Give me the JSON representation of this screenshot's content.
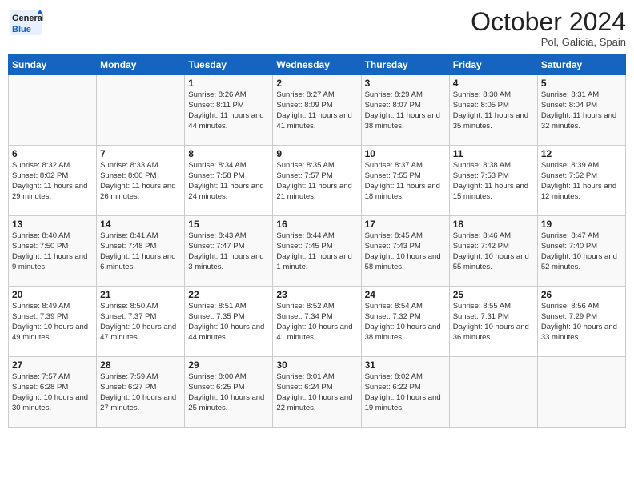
{
  "header": {
    "logo_general": "General",
    "logo_blue": "Blue",
    "month_title": "October 2024",
    "location": "Pol, Galicia, Spain"
  },
  "weekdays": [
    "Sunday",
    "Monday",
    "Tuesday",
    "Wednesday",
    "Thursday",
    "Friday",
    "Saturday"
  ],
  "weeks": [
    [
      {
        "day": "",
        "sunrise": "",
        "sunset": "",
        "daylight": ""
      },
      {
        "day": "",
        "sunrise": "",
        "sunset": "",
        "daylight": ""
      },
      {
        "day": "1",
        "sunrise": "Sunrise: 8:26 AM",
        "sunset": "Sunset: 8:11 PM",
        "daylight": "Daylight: 11 hours and 44 minutes."
      },
      {
        "day": "2",
        "sunrise": "Sunrise: 8:27 AM",
        "sunset": "Sunset: 8:09 PM",
        "daylight": "Daylight: 11 hours and 41 minutes."
      },
      {
        "day": "3",
        "sunrise": "Sunrise: 8:29 AM",
        "sunset": "Sunset: 8:07 PM",
        "daylight": "Daylight: 11 hours and 38 minutes."
      },
      {
        "day": "4",
        "sunrise": "Sunrise: 8:30 AM",
        "sunset": "Sunset: 8:05 PM",
        "daylight": "Daylight: 11 hours and 35 minutes."
      },
      {
        "day": "5",
        "sunrise": "Sunrise: 8:31 AM",
        "sunset": "Sunset: 8:04 PM",
        "daylight": "Daylight: 11 hours and 32 minutes."
      }
    ],
    [
      {
        "day": "6",
        "sunrise": "Sunrise: 8:32 AM",
        "sunset": "Sunset: 8:02 PM",
        "daylight": "Daylight: 11 hours and 29 minutes."
      },
      {
        "day": "7",
        "sunrise": "Sunrise: 8:33 AM",
        "sunset": "Sunset: 8:00 PM",
        "daylight": "Daylight: 11 hours and 26 minutes."
      },
      {
        "day": "8",
        "sunrise": "Sunrise: 8:34 AM",
        "sunset": "Sunset: 7:58 PM",
        "daylight": "Daylight: 11 hours and 24 minutes."
      },
      {
        "day": "9",
        "sunrise": "Sunrise: 8:35 AM",
        "sunset": "Sunset: 7:57 PM",
        "daylight": "Daylight: 11 hours and 21 minutes."
      },
      {
        "day": "10",
        "sunrise": "Sunrise: 8:37 AM",
        "sunset": "Sunset: 7:55 PM",
        "daylight": "Daylight: 11 hours and 18 minutes."
      },
      {
        "day": "11",
        "sunrise": "Sunrise: 8:38 AM",
        "sunset": "Sunset: 7:53 PM",
        "daylight": "Daylight: 11 hours and 15 minutes."
      },
      {
        "day": "12",
        "sunrise": "Sunrise: 8:39 AM",
        "sunset": "Sunset: 7:52 PM",
        "daylight": "Daylight: 11 hours and 12 minutes."
      }
    ],
    [
      {
        "day": "13",
        "sunrise": "Sunrise: 8:40 AM",
        "sunset": "Sunset: 7:50 PM",
        "daylight": "Daylight: 11 hours and 9 minutes."
      },
      {
        "day": "14",
        "sunrise": "Sunrise: 8:41 AM",
        "sunset": "Sunset: 7:48 PM",
        "daylight": "Daylight: 11 hours and 6 minutes."
      },
      {
        "day": "15",
        "sunrise": "Sunrise: 8:43 AM",
        "sunset": "Sunset: 7:47 PM",
        "daylight": "Daylight: 11 hours and 3 minutes."
      },
      {
        "day": "16",
        "sunrise": "Sunrise: 8:44 AM",
        "sunset": "Sunset: 7:45 PM",
        "daylight": "Daylight: 11 hours and 1 minute."
      },
      {
        "day": "17",
        "sunrise": "Sunrise: 8:45 AM",
        "sunset": "Sunset: 7:43 PM",
        "daylight": "Daylight: 10 hours and 58 minutes."
      },
      {
        "day": "18",
        "sunrise": "Sunrise: 8:46 AM",
        "sunset": "Sunset: 7:42 PM",
        "daylight": "Daylight: 10 hours and 55 minutes."
      },
      {
        "day": "19",
        "sunrise": "Sunrise: 8:47 AM",
        "sunset": "Sunset: 7:40 PM",
        "daylight": "Daylight: 10 hours and 52 minutes."
      }
    ],
    [
      {
        "day": "20",
        "sunrise": "Sunrise: 8:49 AM",
        "sunset": "Sunset: 7:39 PM",
        "daylight": "Daylight: 10 hours and 49 minutes."
      },
      {
        "day": "21",
        "sunrise": "Sunrise: 8:50 AM",
        "sunset": "Sunset: 7:37 PM",
        "daylight": "Daylight: 10 hours and 47 minutes."
      },
      {
        "day": "22",
        "sunrise": "Sunrise: 8:51 AM",
        "sunset": "Sunset: 7:35 PM",
        "daylight": "Daylight: 10 hours and 44 minutes."
      },
      {
        "day": "23",
        "sunrise": "Sunrise: 8:52 AM",
        "sunset": "Sunset: 7:34 PM",
        "daylight": "Daylight: 10 hours and 41 minutes."
      },
      {
        "day": "24",
        "sunrise": "Sunrise: 8:54 AM",
        "sunset": "Sunset: 7:32 PM",
        "daylight": "Daylight: 10 hours and 38 minutes."
      },
      {
        "day": "25",
        "sunrise": "Sunrise: 8:55 AM",
        "sunset": "Sunset: 7:31 PM",
        "daylight": "Daylight: 10 hours and 36 minutes."
      },
      {
        "day": "26",
        "sunrise": "Sunrise: 8:56 AM",
        "sunset": "Sunset: 7:29 PM",
        "daylight": "Daylight: 10 hours and 33 minutes."
      }
    ],
    [
      {
        "day": "27",
        "sunrise": "Sunrise: 7:57 AM",
        "sunset": "Sunset: 6:28 PM",
        "daylight": "Daylight: 10 hours and 30 minutes."
      },
      {
        "day": "28",
        "sunrise": "Sunrise: 7:59 AM",
        "sunset": "Sunset: 6:27 PM",
        "daylight": "Daylight: 10 hours and 27 minutes."
      },
      {
        "day": "29",
        "sunrise": "Sunrise: 8:00 AM",
        "sunset": "Sunset: 6:25 PM",
        "daylight": "Daylight: 10 hours and 25 minutes."
      },
      {
        "day": "30",
        "sunrise": "Sunrise: 8:01 AM",
        "sunset": "Sunset: 6:24 PM",
        "daylight": "Daylight: 10 hours and 22 minutes."
      },
      {
        "day": "31",
        "sunrise": "Sunrise: 8:02 AM",
        "sunset": "Sunset: 6:22 PM",
        "daylight": "Daylight: 10 hours and 19 minutes."
      },
      {
        "day": "",
        "sunrise": "",
        "sunset": "",
        "daylight": ""
      },
      {
        "day": "",
        "sunrise": "",
        "sunset": "",
        "daylight": ""
      }
    ]
  ]
}
